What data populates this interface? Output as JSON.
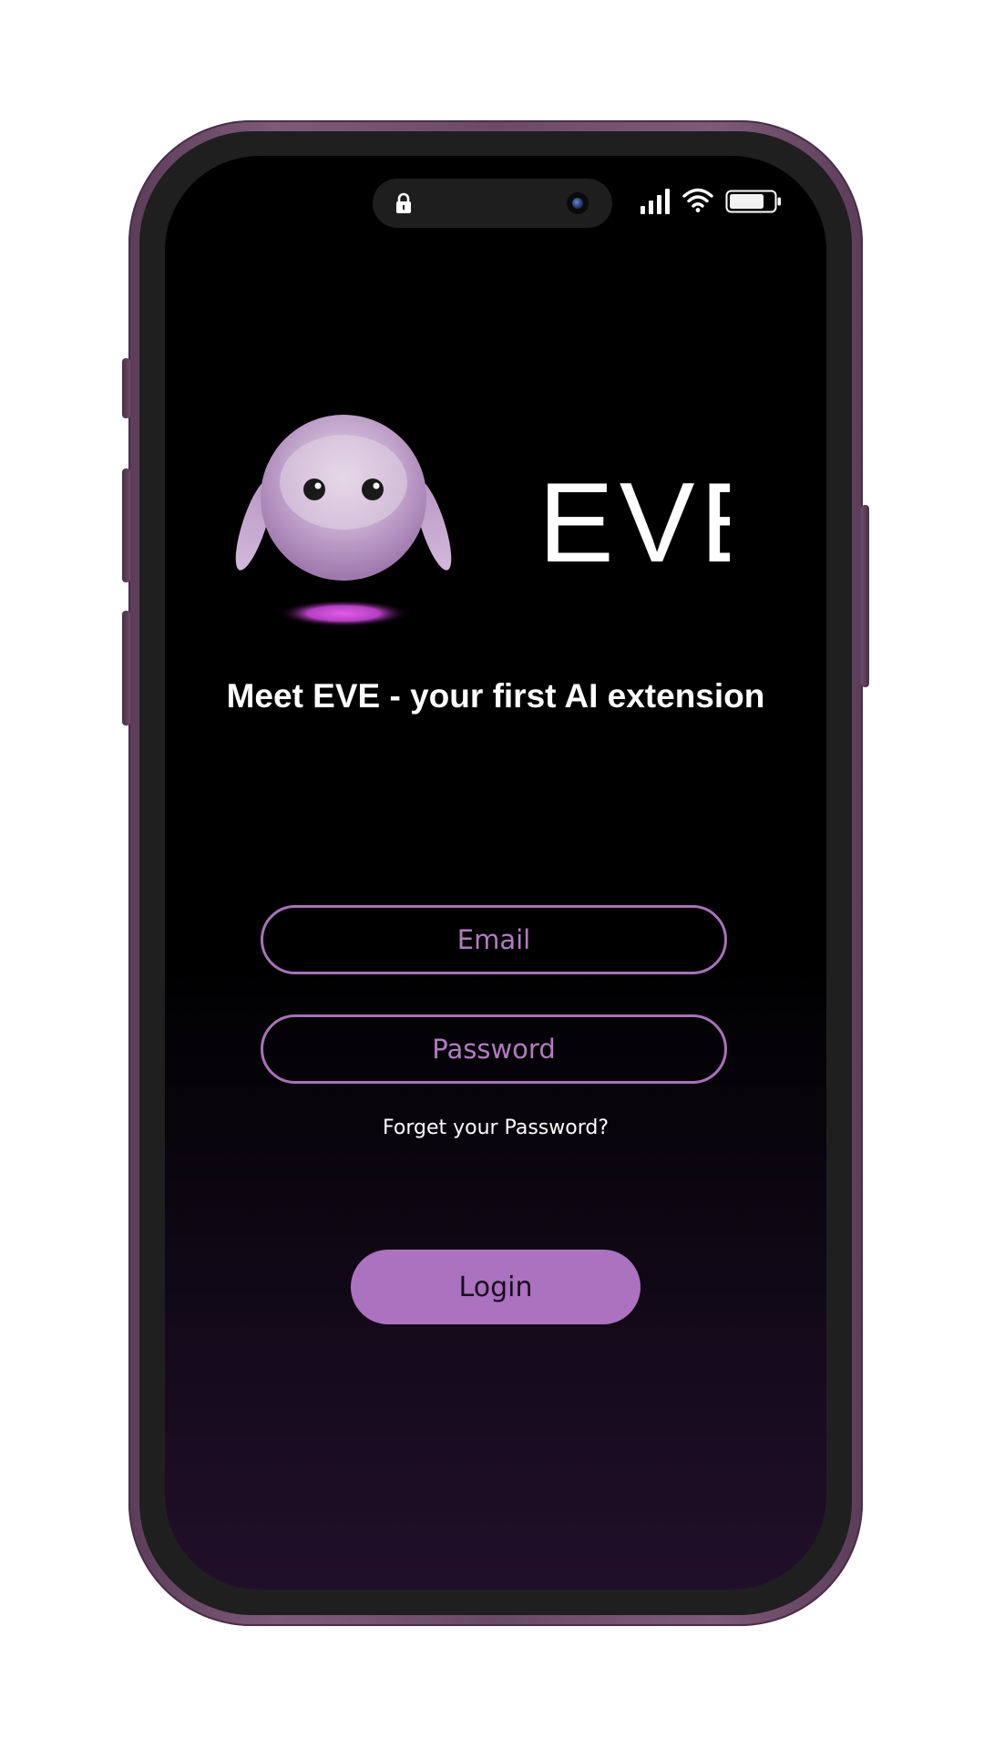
{
  "app": {
    "brand_name": "EVE",
    "headline": "Meet EVE - your first AI extension"
  },
  "status_bar": {
    "icons": [
      "lock-icon",
      "camera-icon",
      "signal-icon",
      "wifi-icon",
      "battery-icon"
    ]
  },
  "login_form": {
    "email_placeholder": "Email",
    "password_placeholder": "Password",
    "forgot_password_label": "Forget your Password?",
    "login_label": "Login"
  },
  "colors": {
    "accent": "#ab72bf",
    "field_border": "#a971b8",
    "phone_frame": "#6b4a67",
    "screen_bottom": "#210f29"
  }
}
